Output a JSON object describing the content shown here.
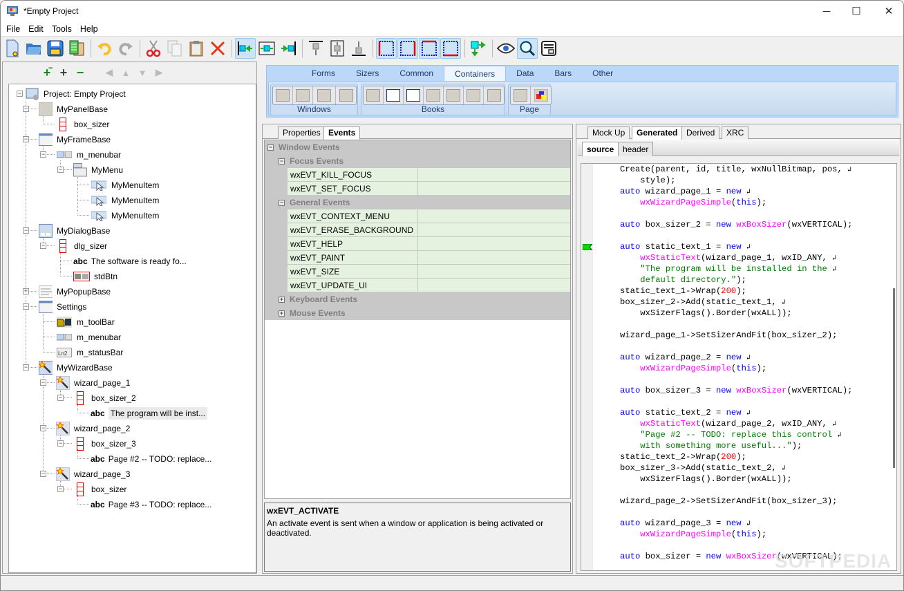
{
  "window": {
    "title": "*Empty Project",
    "controls": {
      "minimize": "─",
      "maximize": "☐",
      "close": "✕"
    }
  },
  "menubar": {
    "items": [
      "File",
      "Edit",
      "Tools",
      "Help"
    ]
  },
  "toolbar": {
    "buttons": [
      {
        "name": "new-project",
        "icon": "new-file-icon"
      },
      {
        "name": "open-project",
        "icon": "folder-open-icon"
      },
      {
        "name": "save-project",
        "icon": "save-icon"
      },
      {
        "name": "generate-code",
        "icon": "generate-icon"
      },
      {
        "name": "undo",
        "icon": "undo-icon"
      },
      {
        "name": "redo",
        "icon": "redo-icon"
      },
      {
        "name": "cut",
        "icon": "cut-icon"
      },
      {
        "name": "copy",
        "icon": "copy-icon"
      },
      {
        "name": "paste",
        "icon": "paste-icon"
      },
      {
        "name": "delete",
        "icon": "delete-icon"
      },
      {
        "name": "align-left",
        "icon": "align-left-icon"
      },
      {
        "name": "align-center",
        "icon": "align-center-h-icon"
      },
      {
        "name": "align-right",
        "icon": "align-right-icon"
      },
      {
        "name": "align-top",
        "icon": "align-top-icon"
      },
      {
        "name": "align-center-v",
        "icon": "align-center-v-icon"
      },
      {
        "name": "align-bottom",
        "icon": "align-bottom-icon"
      },
      {
        "name": "border-left",
        "icon": "border-left-icon"
      },
      {
        "name": "border-right",
        "icon": "border-right-icon"
      },
      {
        "name": "border-top",
        "icon": "border-top-icon"
      },
      {
        "name": "border-bottom",
        "icon": "border-bottom-icon"
      },
      {
        "name": "toggle-orientation",
        "icon": "orientation-icon"
      },
      {
        "name": "preview",
        "icon": "eye-icon"
      },
      {
        "name": "magnify",
        "icon": "magnify-icon"
      },
      {
        "name": "xrc-preview",
        "icon": "form-icon"
      }
    ]
  },
  "tree_toolbar": {
    "buttons": [
      "expand-all",
      "add",
      "remove",
      "move-left",
      "move-up",
      "move-down",
      "move-right"
    ]
  },
  "tree": {
    "nodes": [
      {
        "label": "Project: Empty Project",
        "level": 0,
        "icon": "project-icon",
        "expanded": true
      },
      {
        "label": "MyPanelBase",
        "level": 1,
        "icon": "panel-icon",
        "expanded": true
      },
      {
        "label": "box_sizer",
        "level": 2,
        "icon": "sizer-icon"
      },
      {
        "label": "MyFrameBase",
        "level": 1,
        "icon": "frame-icon",
        "expanded": true
      },
      {
        "label": "m_menubar",
        "level": 2,
        "icon": "menubar-icon",
        "expanded": true
      },
      {
        "label": "MyMenu",
        "level": 3,
        "icon": "menu-icon",
        "expanded": true
      },
      {
        "label": "MyMenuItem",
        "level": 4,
        "icon": "menuitem-icon"
      },
      {
        "label": "MyMenuItem",
        "level": 4,
        "icon": "menuitem-icon"
      },
      {
        "label": "MyMenuItem",
        "level": 4,
        "icon": "menuitem-icon"
      },
      {
        "label": "MyDialogBase",
        "level": 1,
        "icon": "dialog-icon",
        "expanded": true
      },
      {
        "label": "dlg_sizer",
        "level": 2,
        "icon": "sizer-icon",
        "expanded": true
      },
      {
        "label": "The software is ready fo...",
        "level": 3,
        "icon": "static-text-icon",
        "prefix": "abc"
      },
      {
        "label": "stdBtn",
        "level": 3,
        "icon": "std-buttons-icon"
      },
      {
        "label": "MyPopupBase",
        "level": 1,
        "icon": "popup-icon",
        "expanded": false
      },
      {
        "label": "Settings",
        "level": 1,
        "icon": "frame-icon",
        "expanded": true
      },
      {
        "label": "m_toolBar",
        "level": 2,
        "icon": "toolbar-icon"
      },
      {
        "label": "m_menubar",
        "level": 2,
        "icon": "menubar-icon"
      },
      {
        "label": "m_statusBar",
        "level": 2,
        "icon": "statusbar-icon"
      },
      {
        "label": "MyWizardBase",
        "level": 1,
        "icon": "wizard-icon",
        "expanded": true
      },
      {
        "label": "wizard_page_1",
        "level": 2,
        "icon": "wizard-page-icon",
        "expanded": true
      },
      {
        "label": "box_sizer_2",
        "level": 3,
        "icon": "sizer-icon",
        "expanded": true
      },
      {
        "label": "The program will be inst...",
        "level": 4,
        "icon": "static-text-icon",
        "prefix": "abc",
        "selected": true
      },
      {
        "label": "wizard_page_2",
        "level": 2,
        "icon": "wizard-page-icon",
        "expanded": true
      },
      {
        "label": "box_sizer_3",
        "level": 3,
        "icon": "sizer-icon",
        "expanded": true
      },
      {
        "label": "Page #2 -- TODO: replace...",
        "level": 4,
        "icon": "static-text-icon",
        "prefix": "abc"
      },
      {
        "label": "wizard_page_3",
        "level": 2,
        "icon": "wizard-page-icon",
        "expanded": true
      },
      {
        "label": "box_sizer",
        "level": 3,
        "icon": "sizer-icon",
        "expanded": true
      },
      {
        "label": "Page #3 -- TODO: replace...",
        "level": 4,
        "icon": "static-text-icon",
        "prefix": "abc"
      }
    ]
  },
  "ribbon": {
    "tabs": [
      "Forms",
      "Sizers",
      "Common",
      "Containers",
      "Data",
      "Bars",
      "Other"
    ],
    "active_tab": "Containers",
    "groups": [
      {
        "label": "Windows",
        "buttons": [
          "panel",
          "scrolled-window",
          "split-window",
          "collapsible-pane"
        ]
      },
      {
        "label": "Books",
        "buttons": [
          "notebook",
          "choicebook",
          "listbook",
          "simplebook",
          "auinotebook",
          "toolbook",
          "treebook"
        ]
      },
      {
        "label": "Page",
        "buttons": [
          "page-ctrl",
          "book-page"
        ]
      }
    ]
  },
  "properties_panel": {
    "tabs": [
      "Properties",
      "Events"
    ],
    "active_tab": "Events",
    "rows": [
      {
        "type": "category",
        "label": "Window Events",
        "level": 0,
        "expanded": true
      },
      {
        "type": "category",
        "label": "Focus Events",
        "level": 1,
        "expanded": true
      },
      {
        "type": "event",
        "label": "wxEVT_KILL_FOCUS",
        "value": ""
      },
      {
        "type": "event",
        "label": "wxEVT_SET_FOCUS",
        "value": ""
      },
      {
        "type": "category",
        "label": "General Events",
        "level": 1,
        "expanded": true
      },
      {
        "type": "event",
        "label": "wxEVT_CONTEXT_MENU",
        "value": ""
      },
      {
        "type": "event",
        "label": "wxEVT_ERASE_BACKGROUND",
        "value": ""
      },
      {
        "type": "event",
        "label": "wxEVT_HELP",
        "value": ""
      },
      {
        "type": "event",
        "label": "wxEVT_PAINT",
        "value": ""
      },
      {
        "type": "event",
        "label": "wxEVT_SIZE",
        "value": ""
      },
      {
        "type": "event",
        "label": "wxEVT_UPDATE_UI",
        "value": ""
      },
      {
        "type": "category",
        "label": "Keyboard Events",
        "level": 1,
        "expanded": false
      },
      {
        "type": "category",
        "label": "Mouse Events",
        "level": 1,
        "expanded": false
      }
    ],
    "description": {
      "title": "wxEVT_ACTIVATE",
      "text": "An activate event is sent when a window or application is being activated or deactivated."
    }
  },
  "code_panel": {
    "tabs": [
      "Mock Up",
      "Generated",
      "Derived",
      "XRC"
    ],
    "active_tab": "Generated",
    "subtabs": [
      "source",
      "header"
    ],
    "active_subtab": "source",
    "bookmark_line": 8,
    "lines": [
      [
        [
          "",
          "Create(parent, id, title, wxNullBitmap, pos, "
        ],
        [
          "wrap",
          "↲"
        ]
      ],
      [
        [
          "",
          "    style);"
        ]
      ],
      [
        [
          "kw",
          "auto"
        ],
        [
          "",
          " wizard_page_1 = "
        ],
        [
          "kw",
          "new"
        ],
        [
          "",
          " "
        ],
        [
          "wrap",
          "↲"
        ]
      ],
      [
        [
          "",
          "    "
        ],
        [
          "ty",
          "wxWizardPageSimple"
        ],
        [
          "",
          "("
        ],
        [
          "kw",
          "this"
        ],
        [
          "",
          ");"
        ]
      ],
      [],
      [
        [
          "kw",
          "auto"
        ],
        [
          "",
          " box_sizer_2 = "
        ],
        [
          "kw",
          "new"
        ],
        [
          "",
          " "
        ],
        [
          "ty",
          "wxBoxSizer"
        ],
        [
          "",
          "(wxVERTICAL);"
        ]
      ],
      [],
      [
        [
          "kw",
          "auto"
        ],
        [
          "",
          " static_text_1 = "
        ],
        [
          "kw",
          "new"
        ],
        [
          "",
          " "
        ],
        [
          "wrap",
          "↲"
        ]
      ],
      [
        [
          "",
          "    "
        ],
        [
          "ty",
          "wxStaticText"
        ],
        [
          "",
          "(wizard_page_1, wxID_ANY, "
        ],
        [
          "wrap",
          "↲"
        ]
      ],
      [
        [
          "",
          "    "
        ],
        [
          "str",
          "\"The program will be installed in the "
        ],
        [
          "wrap",
          "↲"
        ]
      ],
      [
        [
          "",
          "    "
        ],
        [
          "str",
          "default directory.\""
        ],
        [
          "",
          ");"
        ]
      ],
      [
        [
          "",
          "static_text_1->Wrap("
        ],
        [
          "num",
          "200"
        ],
        [
          "",
          ");"
        ]
      ],
      [
        [
          "",
          "box_sizer_2->Add(static_text_1, "
        ],
        [
          "wrap",
          "↲"
        ]
      ],
      [
        [
          "",
          "    wxSizerFlags().Border(wxALL));"
        ]
      ],
      [],
      [
        [
          "",
          "wizard_page_1->SetSizerAndFit(box_sizer_2);"
        ]
      ],
      [],
      [
        [
          "kw",
          "auto"
        ],
        [
          "",
          " wizard_page_2 = "
        ],
        [
          "kw",
          "new"
        ],
        [
          "",
          " "
        ],
        [
          "wrap",
          "↲"
        ]
      ],
      [
        [
          "",
          "    "
        ],
        [
          "ty",
          "wxWizardPageSimple"
        ],
        [
          "",
          "("
        ],
        [
          "kw",
          "this"
        ],
        [
          "",
          ");"
        ]
      ],
      [],
      [
        [
          "kw",
          "auto"
        ],
        [
          "",
          " box_sizer_3 = "
        ],
        [
          "kw",
          "new"
        ],
        [
          "",
          " "
        ],
        [
          "ty",
          "wxBoxSizer"
        ],
        [
          "",
          "(wxVERTICAL);"
        ]
      ],
      [],
      [
        [
          "kw",
          "auto"
        ],
        [
          "",
          " static_text_2 = "
        ],
        [
          "kw",
          "new"
        ],
        [
          "",
          " "
        ],
        [
          "wrap",
          "↲"
        ]
      ],
      [
        [
          "",
          "    "
        ],
        [
          "ty",
          "wxStaticText"
        ],
        [
          "",
          "(wizard_page_2, wxID_ANY, "
        ],
        [
          "wrap",
          "↲"
        ]
      ],
      [
        [
          "",
          "    "
        ],
        [
          "str",
          "\"Page #2 -- TODO: replace this control "
        ],
        [
          "wrap",
          "↲"
        ]
      ],
      [
        [
          "",
          "    "
        ],
        [
          "str",
          "with something more useful...\""
        ],
        [
          "",
          ");"
        ]
      ],
      [
        [
          "",
          "static_text_2->Wrap("
        ],
        [
          "num",
          "200"
        ],
        [
          "",
          ");"
        ]
      ],
      [
        [
          "",
          "box_sizer_3->Add(static_text_2, "
        ],
        [
          "wrap",
          "↲"
        ]
      ],
      [
        [
          "",
          "    wxSizerFlags().Border(wxALL));"
        ]
      ],
      [],
      [
        [
          "",
          "wizard_page_2->SetSizerAndFit(box_sizer_3);"
        ]
      ],
      [],
      [
        [
          "kw",
          "auto"
        ],
        [
          "",
          " wizard_page_3 = "
        ],
        [
          "kw",
          "new"
        ],
        [
          "",
          " "
        ],
        [
          "wrap",
          "↲"
        ]
      ],
      [
        [
          "",
          "    "
        ],
        [
          "ty",
          "wxWizardPageSimple"
        ],
        [
          "",
          "("
        ],
        [
          "kw",
          "this"
        ],
        [
          "",
          ");"
        ]
      ],
      [],
      [
        [
          "kw",
          "auto"
        ],
        [
          "",
          " box_sizer = "
        ],
        [
          "kw",
          "new"
        ],
        [
          "",
          " "
        ],
        [
          "ty",
          "wxBoxSizer"
        ],
        [
          "",
          "(wxVERTICAL);"
        ]
      ]
    ]
  },
  "watermark": "SOFTPEDIA"
}
